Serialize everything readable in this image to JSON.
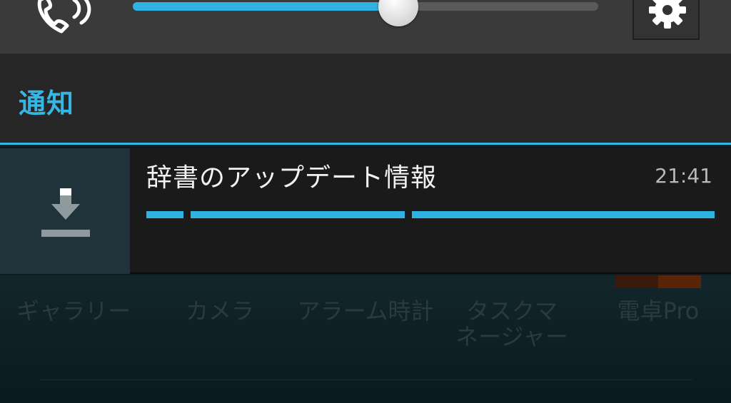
{
  "volume": {
    "level": 0.57
  },
  "header": {
    "title": "通知"
  },
  "notification": {
    "title": "辞書のアップデート情報",
    "time": "21:41"
  },
  "launcher_apps": [
    {
      "label": "ギャラリー"
    },
    {
      "label": "カメラ"
    },
    {
      "label": "アラーム時計"
    },
    {
      "label": "タスクマ\nネージャー"
    },
    {
      "label": "電卓Pro"
    }
  ],
  "colors": {
    "accent": "#35b6e4",
    "progress": "#2fb3e2"
  },
  "icons": {
    "ringer": "phone-volume-icon",
    "settings": "gear-icon",
    "notification": "download-icon"
  }
}
